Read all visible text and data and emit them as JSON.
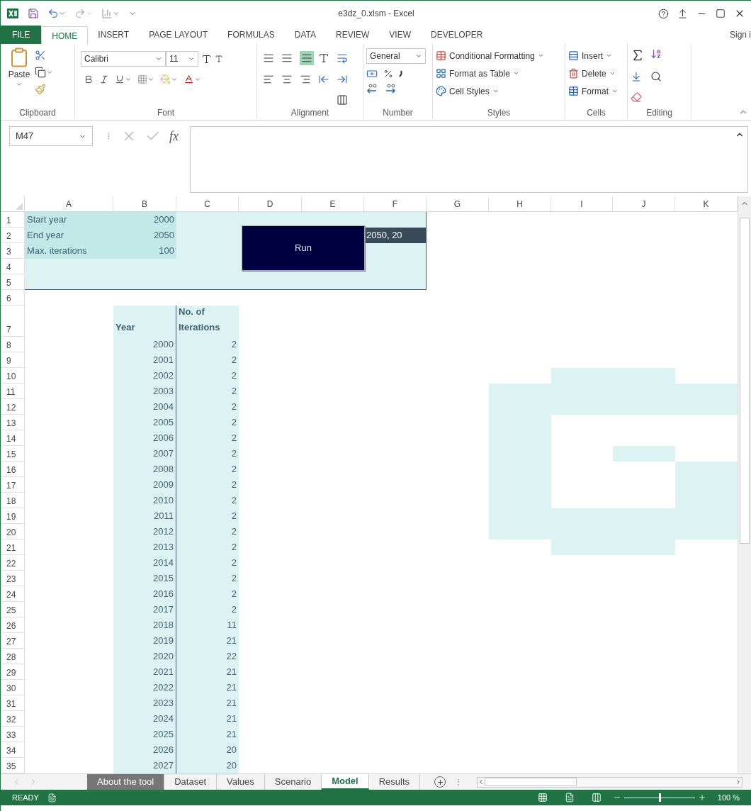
{
  "window": {
    "title": "e3dz_0.xlsm - Excel"
  },
  "ribbon_tabs": [
    {
      "label": "FILE",
      "kind": "file",
      "selected": false
    },
    {
      "label": "HOME",
      "kind": "tab",
      "selected": true
    },
    {
      "label": "INSERT",
      "kind": "tab",
      "selected": false
    },
    {
      "label": "PAGE LAYOUT",
      "kind": "tab",
      "selected": false
    },
    {
      "label": "FORMULAS",
      "kind": "tab",
      "selected": false
    },
    {
      "label": "DATA",
      "kind": "tab",
      "selected": false
    },
    {
      "label": "REVIEW",
      "kind": "tab",
      "selected": false
    },
    {
      "label": "VIEW",
      "kind": "tab",
      "selected": false
    },
    {
      "label": "DEVELOPER",
      "kind": "tab",
      "selected": false
    }
  ],
  "account": "Sign i",
  "ribbon": {
    "clipboard": {
      "paste": "Paste",
      "label": "Clipboard"
    },
    "font": {
      "name": "Calibri",
      "size": "11",
      "label": "Font"
    },
    "alignment": {
      "label": "Alignment"
    },
    "number": {
      "format": "General",
      "label": "Number"
    },
    "styles": {
      "buttons": [
        "Conditional Formatting",
        "Format as Table",
        "Cell Styles"
      ],
      "label": "Styles"
    },
    "cells": {
      "buttons": [
        "Insert",
        "Delete",
        "Format"
      ],
      "label": "Cells"
    },
    "editing": {
      "label": "Editing"
    }
  },
  "formula_bar": {
    "name_box": "M47",
    "function_label": "fx"
  },
  "sheet": {
    "columns": [
      "A",
      "B",
      "C",
      "D",
      "E",
      "F",
      "G",
      "H",
      "I",
      "J",
      "K"
    ],
    "row_numbers": [
      "1",
      "2",
      "3",
      "4",
      "5",
      "6",
      "7",
      "8",
      "9",
      "10",
      "11",
      "12",
      "13",
      "14",
      "15",
      "16",
      "17",
      "18",
      "19",
      "20",
      "21",
      "22",
      "23",
      "24",
      "25",
      "26",
      "27",
      "28",
      "29",
      "30",
      "31",
      "32",
      "33",
      "34",
      "35"
    ],
    "inputs": [
      {
        "label": "Start year",
        "value": "2000"
      },
      {
        "label": "End year",
        "value": "2050"
      },
      {
        "label": "Max. iterations",
        "value": "100"
      }
    ],
    "status_cell": "2050, 20",
    "run_button": "Run",
    "results": {
      "columns": [
        "Year",
        "No. of Iterations"
      ],
      "rows": [
        {
          "year": "2000",
          "iterations": "2"
        },
        {
          "year": "2001",
          "iterations": "2"
        },
        {
          "year": "2002",
          "iterations": "2"
        },
        {
          "year": "2003",
          "iterations": "2"
        },
        {
          "year": "2004",
          "iterations": "2"
        },
        {
          "year": "2005",
          "iterations": "2"
        },
        {
          "year": "2006",
          "iterations": "2"
        },
        {
          "year": "2007",
          "iterations": "2"
        },
        {
          "year": "2008",
          "iterations": "2"
        },
        {
          "year": "2009",
          "iterations": "2"
        },
        {
          "year": "2010",
          "iterations": "2"
        },
        {
          "year": "2011",
          "iterations": "2"
        },
        {
          "year": "2012",
          "iterations": "2"
        },
        {
          "year": "2013",
          "iterations": "2"
        },
        {
          "year": "2014",
          "iterations": "2"
        },
        {
          "year": "2015",
          "iterations": "2"
        },
        {
          "year": "2016",
          "iterations": "2"
        },
        {
          "year": "2017",
          "iterations": "2"
        },
        {
          "year": "2018",
          "iterations": "11"
        },
        {
          "year": "2019",
          "iterations": "21"
        },
        {
          "year": "2020",
          "iterations": "22"
        },
        {
          "year": "2021",
          "iterations": "21"
        },
        {
          "year": "2022",
          "iterations": "21"
        },
        {
          "year": "2023",
          "iterations": "21"
        },
        {
          "year": "2024",
          "iterations": "21"
        },
        {
          "year": "2025",
          "iterations": "21"
        },
        {
          "year": "2026",
          "iterations": "20"
        },
        {
          "year": "2027",
          "iterations": "20"
        }
      ]
    }
  },
  "sheet_tabs": [
    {
      "label": "About the tool",
      "selected": false,
      "color": "#767676"
    },
    {
      "label": "Dataset",
      "selected": false
    },
    {
      "label": "Values",
      "selected": false
    },
    {
      "label": "Scenario",
      "selected": false
    },
    {
      "label": "Model",
      "selected": true
    },
    {
      "label": "Results",
      "selected": false
    }
  ],
  "status_bar": {
    "mode": "READY",
    "zoom": "100 %",
    "level": 0.5
  }
}
